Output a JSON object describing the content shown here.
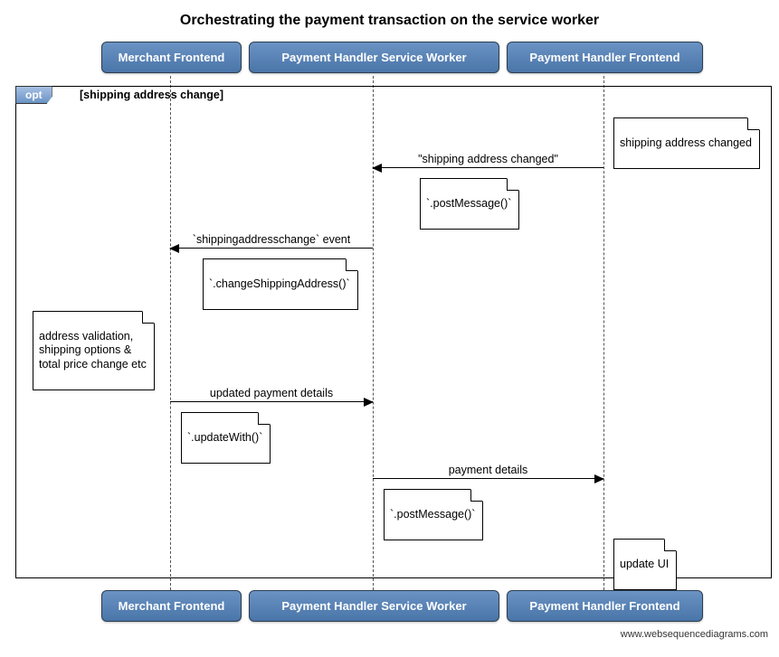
{
  "title": "Orchestrating the payment transaction on the service worker",
  "participants": {
    "p1": "Merchant Frontend",
    "p2": "Payment Handler Service Worker",
    "p3": "Payment Handler Frontend"
  },
  "fragment": {
    "tag": "opt",
    "guard": "[shipping address change]"
  },
  "notes": {
    "n_addr_changed": "shipping address changed",
    "n_post1": "`.postMessage()`",
    "n_change_addr": "`.changeShippingAddress()`",
    "n_validation": "address validation,\nshipping options &\ntotal price change etc",
    "n_update_with": "`.updateWith()`",
    "n_post2": "`.postMessage()`",
    "n_update_ui": "update UI"
  },
  "messages": {
    "m1": "\"shipping address changed\"",
    "m2": "`shippingaddresschange` event",
    "m3": "updated payment details",
    "m4": "payment details"
  },
  "watermark": "www.websequencediagrams.com"
}
